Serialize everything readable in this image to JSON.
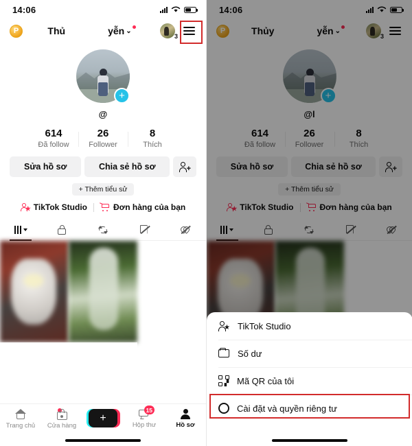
{
  "status_bar": {
    "time": "14:06",
    "signal_icon": "signal-bars-icon",
    "wifi_icon": "wifi-icon",
    "battery_icon": "battery-icon"
  },
  "header": {
    "coin_label": "P",
    "name_part_1": "Thủ",
    "name_part_2": "yễn",
    "name_right_full": "Thủy",
    "chevron": "⌄",
    "avatar_count": "3",
    "menu_icon": "hamburger-menu-icon"
  },
  "profile": {
    "handle_left": "@",
    "handle_right": "@l",
    "add_story_label": "+",
    "stats": [
      {
        "value": "614",
        "label": "Đã follow"
      },
      {
        "value": "26",
        "label": "Follower"
      },
      {
        "value": "8",
        "label": "Thích"
      }
    ],
    "edit_profile": "Sửa hồ sơ",
    "share_profile": "Chia sẻ hồ sơ",
    "add_friends_icon": "add-user-icon",
    "add_bio": "+ Thêm tiểu sử",
    "link_studio": "TikTok Studio",
    "link_orders": "Đơn hàng của bạn"
  },
  "tabs": [
    {
      "icon": "grid-videos-icon",
      "active": true
    },
    {
      "icon": "lock-private-icon",
      "active": false
    },
    {
      "icon": "repost-icon",
      "active": false
    },
    {
      "icon": "bookmark-off-icon",
      "active": false
    },
    {
      "icon": "heart-off-icon",
      "active": false
    }
  ],
  "bottom_nav": [
    {
      "icon": "home-icon",
      "label": "Trang chủ",
      "active": false,
      "badge": ""
    },
    {
      "icon": "shop-bag-icon",
      "label": "Cửa hàng",
      "active": false,
      "badge": "dot"
    },
    {
      "icon": "create-plus-icon",
      "label": "+",
      "active": false,
      "badge": ""
    },
    {
      "icon": "inbox-message-icon",
      "label": "Hộp thư",
      "active": false,
      "badge": "15"
    },
    {
      "icon": "profile-person-icon",
      "label": "Hồ sơ",
      "active": true,
      "badge": ""
    }
  ],
  "sheet": {
    "items": [
      {
        "icon": "tiktok-studio-icon",
        "label": "TikTok Studio"
      },
      {
        "icon": "wallet-icon",
        "label": "Số dư"
      },
      {
        "icon": "qr-code-icon",
        "label": "Mã QR của tôi"
      },
      {
        "icon": "gear-settings-icon",
        "label": "Cài đặt và quyền riêng tư"
      }
    ]
  },
  "highlight": {
    "color": "#d22b2b",
    "targets": [
      "hamburger-menu-icon",
      "settings-and-privacy-item"
    ]
  }
}
